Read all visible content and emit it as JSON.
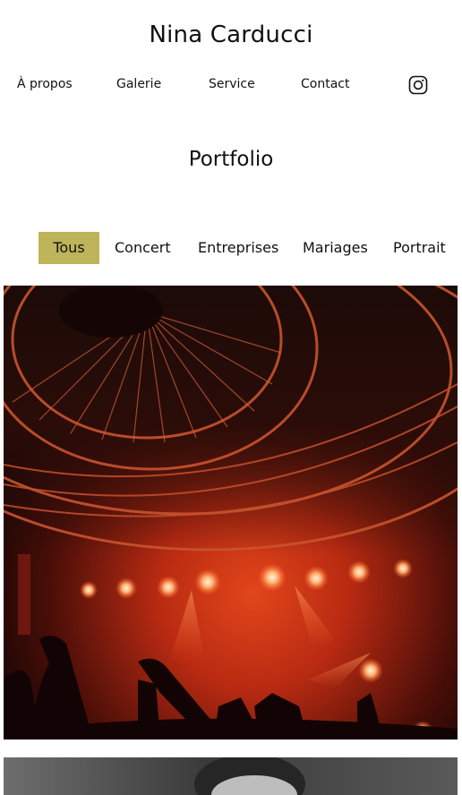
{
  "header": {
    "title": "Nina Carducci"
  },
  "nav": {
    "items": [
      {
        "label": "À propos"
      },
      {
        "label": "Galerie"
      },
      {
        "label": "Service"
      },
      {
        "label": "Contact"
      }
    ],
    "social_icon": "instagram-icon"
  },
  "portfolio": {
    "title": "Portfolio",
    "filters": [
      {
        "label": "Tous",
        "active": true
      },
      {
        "label": "Concert",
        "active": false
      },
      {
        "label": "Entreprises",
        "active": false
      },
      {
        "label": "Mariages",
        "active": false
      },
      {
        "label": "Portrait",
        "active": false
      }
    ],
    "active_filter_color": "#beb45a"
  },
  "gallery": {
    "images": [
      {
        "subject": "concert-stage-photo"
      },
      {
        "subject": "portrait-photo"
      }
    ]
  }
}
